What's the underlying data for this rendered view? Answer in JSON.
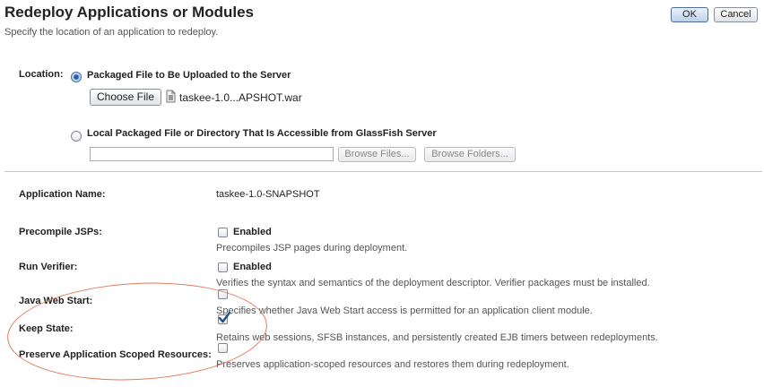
{
  "header": {
    "title": "Redeploy Applications or Modules",
    "subtitle": "Specify the location of an application to redeploy.",
    "ok_label": "OK",
    "cancel_label": "Cancel"
  },
  "location": {
    "label": "Location:",
    "option_packaged": "Packaged File to Be Uploaded to the Server",
    "choose_file_label": "Choose File",
    "selected_file": "taskee-1.0...APSHOT.war",
    "option_local": "Local Packaged File or Directory That Is Accessible from GlassFish Server",
    "local_path_value": "",
    "browse_files_label": "Browse Files...",
    "browse_folders_label": "Browse Folders...",
    "selected_option": "packaged"
  },
  "fields": {
    "app_name_label": "Application Name:",
    "app_name_value": "taskee-1.0-SNAPSHOT",
    "precompile": {
      "label": "Precompile JSPs:",
      "option": "Enabled",
      "checked": false,
      "help": "Precompiles JSP pages during deployment."
    },
    "verifier": {
      "label": "Run Verifier:",
      "option": "Enabled",
      "checked": false,
      "help": "Verifies the syntax and semantics of the deployment descriptor. Verifier packages must be installed."
    },
    "java_web_start": {
      "label": "Java Web Start:",
      "checked": false,
      "help": "Specifies whether Java Web Start access is permitted for an application client module."
    },
    "keep_state": {
      "label": "Keep State:",
      "checked": true,
      "help": "Retains web sessions, SFSB instances, and persistently created EJB timers between redeployments."
    },
    "preserve_resources": {
      "label": "Preserve Application Scoped Resources:",
      "checked": false,
      "help": "Preserves application-scoped resources and restores them during redeployment."
    }
  },
  "colors": {
    "annotation_ellipse": "#e2795f",
    "checkmark": "#1f4f8f"
  },
  "icons": {
    "file": "war-file-icon",
    "check": "checkmark-icon"
  }
}
